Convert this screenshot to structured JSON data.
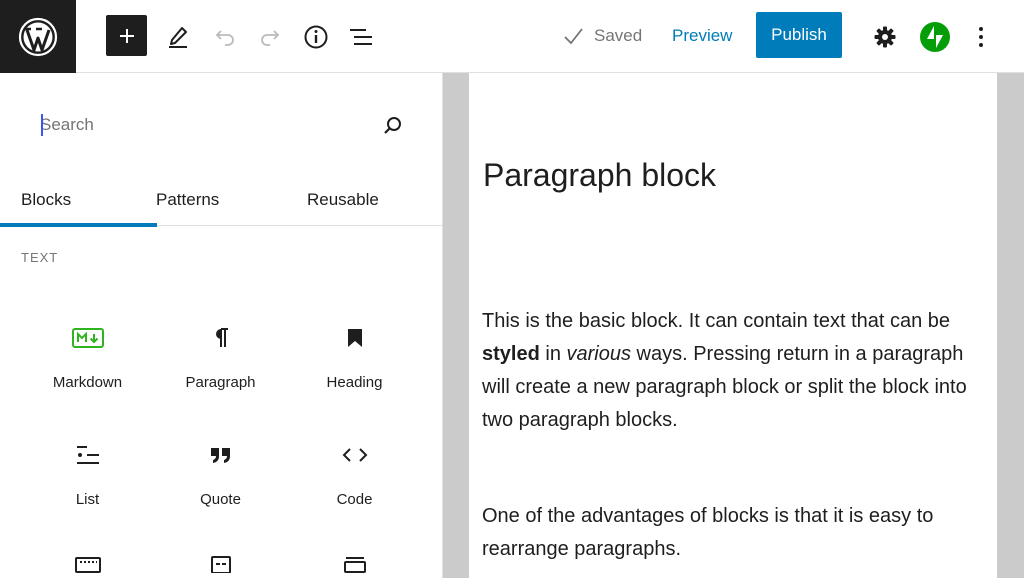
{
  "topbar": {
    "logo_icon": "wordpress-logo",
    "add_icon": "plus-icon",
    "tools_icon": "pencil-icon",
    "undo_icon": "undo-icon",
    "redo_icon": "redo-icon",
    "info_icon": "info-icon",
    "outline_icon": "list-view-icon",
    "saved_label": "Saved",
    "preview_label": "Preview",
    "publish_label": "Publish",
    "settings_icon": "gear-icon",
    "jetpack_icon": "jetpack-icon",
    "more_icon": "kebab-icon",
    "accent": "#007cba"
  },
  "sidebar": {
    "search_placeholder": "Search",
    "tabs": [
      {
        "label": "Blocks",
        "active": true
      },
      {
        "label": "Patterns",
        "active": false
      },
      {
        "label": "Reusable",
        "active": false
      }
    ],
    "category": "TEXT",
    "blocks": [
      {
        "label": "Markdown",
        "icon": "markdown-icon"
      },
      {
        "label": "Paragraph",
        "icon": "pilcrow-icon"
      },
      {
        "label": "Heading",
        "icon": "bookmark-icon"
      },
      {
        "label": "List",
        "icon": "list-icon"
      },
      {
        "label": "Quote",
        "icon": "quote-icon"
      },
      {
        "label": "Code",
        "icon": "code-icon"
      }
    ]
  },
  "editor": {
    "title": "Paragraph block",
    "para1_a": "This is the basic block. It can contain text that can be ",
    "para1_b": "styled",
    "para1_c": " in ",
    "para1_d": "various",
    "para1_e": " ways. Pressing return in a paragraph will create a new paragraph block or split the block into two paragraph blocks.",
    "para2": "One of the advantages of blocks is that it is easy to rearrange  paragraphs."
  }
}
